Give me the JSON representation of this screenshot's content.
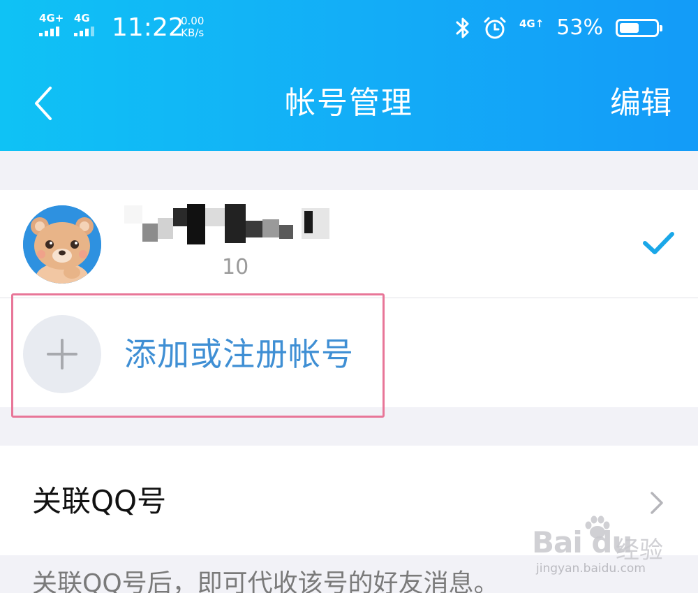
{
  "status_bar": {
    "sim1_label": "4G+",
    "sim2_label": "4G",
    "time": "11:22",
    "net_speed_value": "0.00",
    "net_speed_unit": "KB/s",
    "data_label": "4G",
    "battery_pct": "53%",
    "battery_level": 0.53
  },
  "nav": {
    "title": "帐号管理",
    "edit_label": "编辑",
    "back_icon": "chevron-left-icon"
  },
  "account": {
    "id_fragment": "10",
    "selected": true
  },
  "add_account": {
    "label": "添加或注册帐号"
  },
  "linked": {
    "label": "关联QQ号",
    "hint": "关联QQ号后，即可代收该号的好友消息。"
  },
  "watermark": {
    "brand": "Bai du",
    "cn": "经验",
    "url": "jingyan.baidu.com"
  },
  "colors": {
    "header_start": "#0fc2f5",
    "header_end": "#139bf8",
    "accent_blue": "#3f8fd4",
    "check": "#1aa7e8",
    "highlight": "#e87698"
  }
}
